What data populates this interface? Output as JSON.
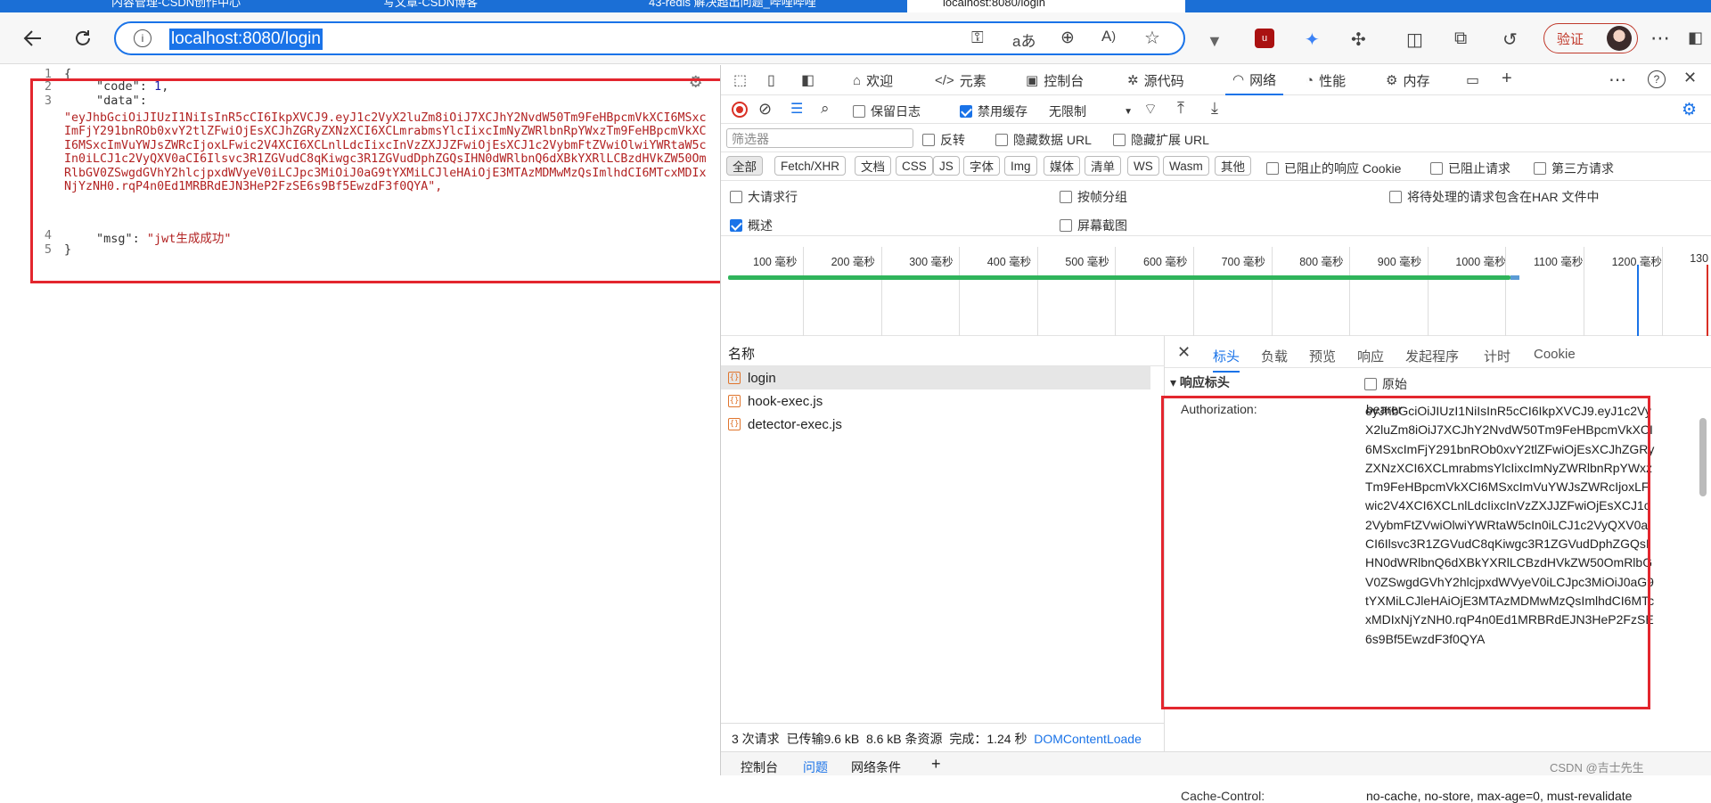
{
  "tabs": [
    {
      "label": "内容管理-CSDN创作中心",
      "active": false
    },
    {
      "label": "写文章-CSDN博客",
      "active": false
    },
    {
      "label": "43-redis 解决超出问题_哔哩哔哩",
      "active": false
    },
    {
      "label": "localhost:8080/login",
      "active": true
    }
  ],
  "address": {
    "url": "localhost:8080/login",
    "verify_label": "验证"
  },
  "json_view": {
    "line_numbers": [
      "1",
      "2",
      "3",
      "4",
      "5"
    ],
    "open_brace": "{",
    "code_key": "\"code\"",
    "code_colon": ": ",
    "code_value": "1",
    "code_comma": ",",
    "data_key": "\"data\"",
    "data_colon": ":",
    "data_value": "\"eyJhbGciOiJIUzI1NiIsInR5cCI6IkpXVCJ9.eyJ1c2VyX2luZm8iOiJ7XCJhY2NvdW50Tm9FeHBpcmVkXCI6MSxcImFjY291bnROb0xvY2tlZFwiOjEsXCJhZGRyZXNzXCI6XCLmrabmsYlcIixcImNyZWRlbnRpYWxzTm9FeHBpcmVkXCI6MSxcImVuYWJsZWRcIjoxLFwic2V4XCI6XCLnlLdcIixcInVzZXJJZFwiOjEsXCJ1c2VybmFtZVwiOlwiYWRtaW5cIn0iLCJ1c2VyQXV0aCI6Ilsvc3R1ZGVudC8qKiwgc3R1ZGVudDphZGQsIHN0dWRlbnQ6dXBkYXRlLCBzdHVkZW50OmRlbGV0ZSwgdGVhY2hlcjpxdWVyeV0iLCJpc3MiOiJ0aG9tYXMiLCJleHAiOjE3MTAzMDMwMzQsImlhdCI6MTcxMDIxNjYzNH0.rqP4n0Ed1MRBRdEJN3HeP2FzSE6s9Bf5EwzdF3f0QYA\",",
    "msg_key": "\"msg\"",
    "msg_colon": ": ",
    "msg_value": "\"jwt生成成功\"",
    "close_brace": "}"
  },
  "devtools": {
    "tabs": [
      "欢迎",
      "元素",
      "控制台",
      "源代码",
      "网络",
      "性能",
      "内存"
    ],
    "active_tab": "网络",
    "toolbar": {
      "preserve_log": "保留日志",
      "disable_cache": "禁用缓存",
      "throttle": "无限制"
    },
    "filter": {
      "placeholder": "筛选器",
      "invert": "反转",
      "hide_data_url": "隐藏数据 URL",
      "hide_ext_url": "隐藏扩展 URL"
    },
    "type_filters": [
      "全部",
      "Fetch/XHR",
      "文档",
      "CSS",
      "JS",
      "字体",
      "Img",
      "媒体",
      "清单",
      "WS",
      "Wasm",
      "其他"
    ],
    "blocked_cookie": "已阻止的响应 Cookie",
    "blocked_requests": "已阻止请求",
    "third_party": "第三方请求",
    "options": {
      "big_rows": "大请求行",
      "group_by_frame": "按帧分组",
      "har_include": "将待处理的请求包含在HAR 文件中",
      "overview": "概述",
      "screenshots": "屏幕截图"
    },
    "timeline_ticks": [
      "100 毫秒",
      "200 毫秒",
      "300 毫秒",
      "400 毫秒",
      "500 毫秒",
      "600 毫秒",
      "700 毫秒",
      "800 毫秒",
      "900 毫秒",
      "1000 毫秒",
      "1100 毫秒",
      "1200 毫秒",
      "130"
    ],
    "name_header": "名称",
    "requests": [
      "login",
      "hook-exec.js",
      "detector-exec.js"
    ],
    "detail_tabs": [
      "标头",
      "负载",
      "预览",
      "响应",
      "发起程序",
      "计时",
      "Cookie"
    ],
    "active_detail_tab": "标头",
    "response_headers_title": "▾ 响应标头",
    "raw_label": "原始",
    "auth_key": "Authorization:",
    "auth_value_line1": "bearer",
    "auth_value": "eyJhbGciOiJIUzI1NiIsInR5cCI6IkpXVCJ9.eyJ1c2VyX2luZm8iOiJ7XCJhY2NvdW50Tm9FeHBpcmVkXCI6MSxcImFjY291bnROb0xvY2tlZFwiOjEsXCJhZGRyZXNzXCI6XCLmrabmsYlcIixcImNyZWRlbnRpYWxzTm9FeHBpcmVkXCI6MSxcImVuYWJsZWRcIjoxLFwic2V4XCI6XCLnlLdcIixcInVzZXJJZFwiOjEsXCJ1c2VybmFtZVwiOlwiYWRtaW5cIn0iLCJ1c2VyQXV0aCI6Ilsvc3R1ZGVudC8qKiwgc3R1ZGVudDphZGQsIHN0dWRlbnQ6dXBkYXRlLCBzdHVkZW50OmRlbGV0ZSwgdGVhY2hlcjpxdWVyeV0iLCJpc3MiOiJ0aG9tYXMiLCJleHAiOjE3MTAzMDMwMzQsImlhdCI6MTcxMDIxNjYzNH0.rqP4n0Ed1MRBRdEJN3HeP2FzSE6s9Bf5EwzdF3f0QYA",
    "cache_key": "Cache-Control:",
    "cache_value": "no-cache, no-store, max-age=0, must-revalidate",
    "status_bar": {
      "requests": "3 次请求",
      "transferred": "已传输9.6 kB",
      "resources": "8.6 kB 条资源",
      "finish": "完成：1.24 秒",
      "dcl": "DOMContentLoade"
    },
    "drawer_tabs": [
      "控制台",
      "问题",
      "网络条件"
    ]
  },
  "watermark": "CSDN @吉士先生",
  "colors": {
    "accent": "#1a73e8",
    "highlight_box": "#e3262e",
    "string": "#b22222"
  }
}
